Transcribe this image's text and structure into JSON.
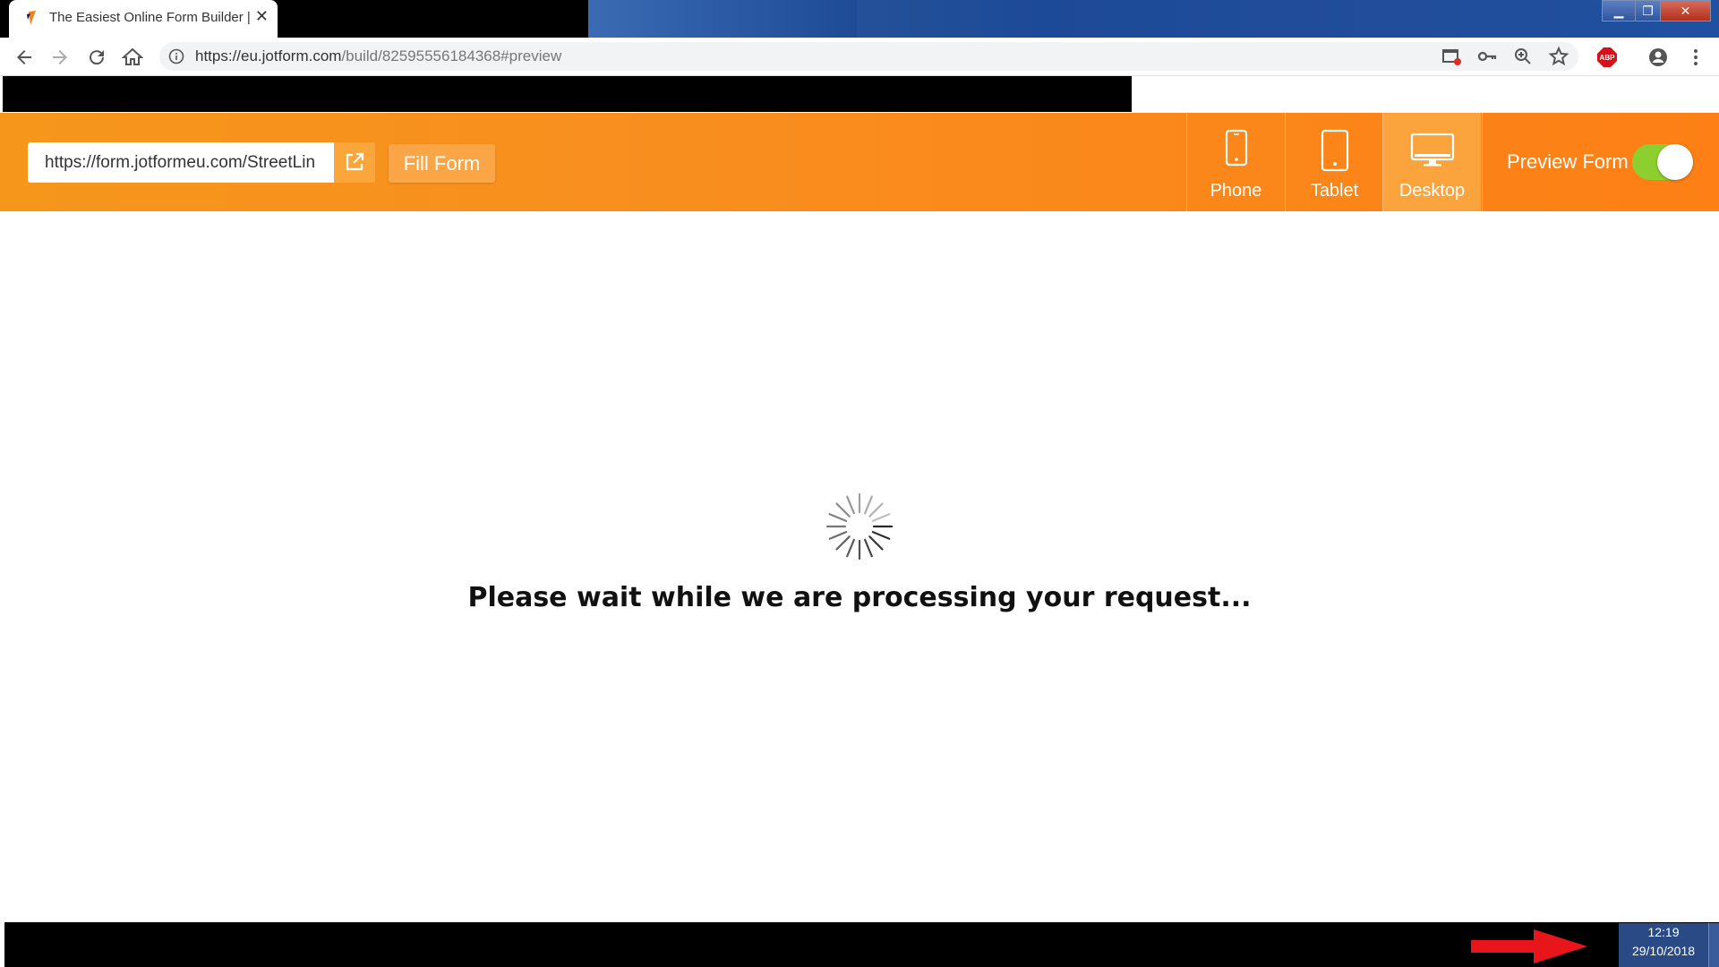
{
  "browser": {
    "tab_title": "The Easiest Online Form Builder |",
    "tab_close": "✕",
    "url_host": "https://eu.jotform.com",
    "url_path": "/build/82595556184368#preview"
  },
  "preview_bar": {
    "form_url": "https://form.jotformeu.com/StreetLin",
    "fill_form_label": "Fill Form",
    "devices": [
      {
        "label": "Phone",
        "active": false
      },
      {
        "label": "Tablet",
        "active": false
      },
      {
        "label": "Desktop",
        "active": true
      }
    ],
    "preview_form_label": "Preview Form",
    "preview_form_enabled": true
  },
  "main": {
    "wait_message": "Please wait while we are processing your request..."
  },
  "taskbar": {
    "time": "12:19",
    "date": "29/10/2018"
  },
  "colors": {
    "orange_start": "#f6961b",
    "orange_end": "#fd7f15",
    "toggle_on": "#8ccf2f",
    "arrow_red": "#e8151b"
  }
}
